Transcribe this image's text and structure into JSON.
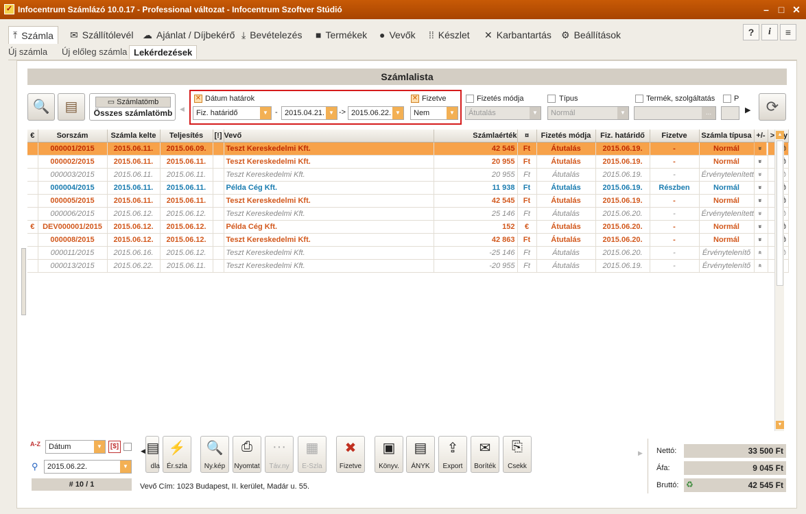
{
  "window": {
    "title": "Infocentrum Számlázó 10.0.17 - Professional változat - Infocentrum Szoftver Stúdió",
    "app_icon_glyph": "✓"
  },
  "main_tabs": [
    {
      "label": "Számla",
      "icon": "upload-icon",
      "glyph": "⤒"
    },
    {
      "label": "Szállítólevél",
      "icon": "envelope-icon",
      "glyph": "✉"
    },
    {
      "label": "Ajánlat / Díjbekérő",
      "icon": "cloud-icon",
      "glyph": "☁"
    },
    {
      "label": "Bevételezés",
      "icon": "download-icon",
      "glyph": "⤓"
    },
    {
      "label": "Termékek",
      "icon": "box-icon",
      "glyph": "■"
    },
    {
      "label": "Vevők",
      "icon": "user-icon",
      "glyph": "●"
    },
    {
      "label": "Készlet",
      "icon": "grid-icon",
      "glyph": "⁞⁞"
    },
    {
      "label": "Karbantartás",
      "icon": "tools-icon",
      "glyph": "✕"
    },
    {
      "label": "Beállítások",
      "icon": "gear-icon",
      "glyph": "⚙"
    }
  ],
  "top_right_icons": {
    "help": "?",
    "info": "i",
    "menu": "≡"
  },
  "sub_tabs": [
    "Új számla",
    "Új előleg számla",
    "Lekérdezések"
  ],
  "list_title": "Számlalista",
  "szamlatomb": {
    "button": "Számlatömb",
    "value": "Összes számlatömb"
  },
  "filters": {
    "datum_hatarok": {
      "label": "Dátum határok",
      "checked": true,
      "field": "Fiz. határidő",
      "from": "2015.04.21.",
      "to": "2015.06.22.",
      "dash": "-",
      "arrow": "->"
    },
    "fizetve": {
      "label": "Fizetve",
      "checked": true,
      "value": "Nem"
    },
    "fizetes_modja": {
      "label": "Fizetés módja",
      "value": "Átutalás"
    },
    "tipus": {
      "label": "Típus",
      "value": "Normál"
    },
    "termek": {
      "label": "Termék, szolgáltatás",
      "ellipsis": "..."
    },
    "p": {
      "label": "P"
    }
  },
  "grid": {
    "headers": [
      "€",
      "Sorszám",
      "Számla kelte",
      "Teljesítés",
      "[!]",
      "Vevő",
      "Számlaérték",
      "¤",
      "Fizetés módja",
      "Fiz. határidő",
      "Fizetve",
      "Számla típusa",
      "+/-",
      ">",
      "Ny"
    ],
    "rows": [
      {
        "cur": "",
        "no": "000001/2015",
        "kelte": "2015.06.11.",
        "telj": "2015.06.09.",
        "vevo": "Teszt Kereskedelmi Kft.",
        "ertek": "42 545",
        "dev": "Ft",
        "mod": "Átutalás",
        "hat": "2015.06.19.",
        "fiz": "-",
        "tip": "Normál",
        "pm": "»",
        "ny": "⎙",
        "cls": "st-normal sel"
      },
      {
        "cur": "",
        "no": "000002/2015",
        "kelte": "2015.06.11.",
        "telj": "2015.06.11.",
        "vevo": "Teszt Kereskedelmi Kft.",
        "ertek": "20 955",
        "dev": "Ft",
        "mod": "Átutalás",
        "hat": "2015.06.19.",
        "fiz": "-",
        "tip": "Normál",
        "pm": "»",
        "ny": "⎙",
        "cls": "st-normal"
      },
      {
        "cur": "",
        "no": "000003/2015",
        "kelte": "2015.06.11.",
        "telj": "2015.06.11.",
        "vevo": "Teszt Kereskedelmi Kft.",
        "ertek": "20 955",
        "dev": "Ft",
        "mod": "Átutalás",
        "hat": "2015.06.19.",
        "fiz": "-",
        "tip": "Érvénytelenített",
        "pm": "»",
        "ny": "⎙",
        "cls": "st-void"
      },
      {
        "cur": "",
        "no": "000004/2015",
        "kelte": "2015.06.11.",
        "telj": "2015.06.11.",
        "vevo": "Példa Cég Kft.",
        "ertek": "11 938",
        "dev": "Ft",
        "mod": "Átutalás",
        "hat": "2015.06.19.",
        "fiz": "Részben",
        "tip": "Normál",
        "pm": "»",
        "ny": "⎙",
        "cls": "st-blue"
      },
      {
        "cur": "",
        "no": "000005/2015",
        "kelte": "2015.06.11.",
        "telj": "2015.06.11.",
        "vevo": "Teszt Kereskedelmi Kft.",
        "ertek": "42 545",
        "dev": "Ft",
        "mod": "Átutalás",
        "hat": "2015.06.19.",
        "fiz": "-",
        "tip": "Normál",
        "pm": "»",
        "ny": "⎙",
        "cls": "st-normal"
      },
      {
        "cur": "",
        "no": "000006/2015",
        "kelte": "2015.06.12.",
        "telj": "2015.06.12.",
        "vevo": "Teszt Kereskedelmi Kft.",
        "ertek": "25 146",
        "dev": "Ft",
        "mod": "Átutalás",
        "hat": "2015.06.20.",
        "fiz": "-",
        "tip": "Érvénytelenített",
        "pm": "»",
        "ny": "⎙",
        "cls": "st-void"
      },
      {
        "cur": "€",
        "no": "DEV000001/2015",
        "kelte": "2015.06.12.",
        "telj": "2015.06.12.",
        "vevo": "Példa Cég Kft.",
        "ertek": "152",
        "dev": "€",
        "mod": "Átutalás",
        "hat": "2015.06.20.",
        "fiz": "-",
        "tip": "Normál",
        "pm": "»",
        "ny": "⎙",
        "cls": "st-normal"
      },
      {
        "cur": "",
        "no": "000008/2015",
        "kelte": "2015.06.12.",
        "telj": "2015.06.12.",
        "vevo": "Teszt Kereskedelmi Kft.",
        "ertek": "42 863",
        "dev": "Ft",
        "mod": "Átutalás",
        "hat": "2015.06.20.",
        "fiz": "-",
        "tip": "Normál",
        "pm": "»",
        "ny": "⎙",
        "cls": "st-normal"
      },
      {
        "cur": "",
        "no": "000011/2015",
        "kelte": "2015.06.16.",
        "telj": "2015.06.12.",
        "vevo": "Teszt Kereskedelmi Kft.",
        "ertek": "-25 146",
        "dev": "Ft",
        "mod": "Átutalás",
        "hat": "2015.06.20.",
        "fiz": "-",
        "tip": "Érvénytelenítő",
        "pm": "«",
        "ny": "⎙",
        "cls": "st-void"
      },
      {
        "cur": "",
        "no": "000013/2015",
        "kelte": "2015.06.22.",
        "telj": "2015.06.11.",
        "vevo": "Teszt Kereskedelmi Kft.",
        "ertek": "-20 955",
        "dev": "Ft",
        "mod": "Átutalás",
        "hat": "2015.06.19.",
        "fiz": "-",
        "tip": "Érvénytelenítő",
        "pm": "«",
        "ny": "",
        "cls": "st-void"
      }
    ]
  },
  "bottom": {
    "sort_label": "Dátum",
    "sort_icon": "A-Z",
    "search_value": "2015.06.22.",
    "dollar": "[$]",
    "record_counter": "# 10 / 1",
    "customer_address": "Vevő Cím: 1023 Budapest, II. kerület, Madár u. 55.",
    "buttons": [
      {
        "label": "dla",
        "glyph": "▤",
        "icon": "partial-icon",
        "dis": false
      },
      {
        "label": "Ér.szla",
        "glyph": "⚡",
        "icon": "void-invoice-icon",
        "dis": false
      },
      {
        "label": "Ny.kép",
        "glyph": "🔍",
        "icon": "preview-icon",
        "dis": false
      },
      {
        "label": "Nyomtat",
        "glyph": "⎙",
        "icon": "printer-icon",
        "dis": false
      },
      {
        "label": "Táv.ny",
        "glyph": "···",
        "icon": "remote-print-icon",
        "dis": true
      },
      {
        "label": "E-Szla",
        "glyph": "▦",
        "icon": "e-invoice-icon",
        "dis": true
      },
      {
        "label": "Fizetve",
        "glyph": "✖",
        "icon": "paid-bag-icon",
        "dis": false
      },
      {
        "label": "Könyv.",
        "glyph": "▣",
        "icon": "accounting-icon",
        "dis": false
      },
      {
        "label": "ÁNYK",
        "glyph": "▤",
        "icon": "anyk-icon",
        "dis": false
      },
      {
        "label": "Export",
        "glyph": "⇪",
        "icon": "export-icon",
        "dis": false
      },
      {
        "label": "Boríték",
        "glyph": "✉",
        "icon": "envelope-print-icon",
        "dis": false
      },
      {
        "label": "Csekk",
        "glyph": "⎘",
        "icon": "check-print-icon",
        "dis": false
      }
    ],
    "totals": {
      "netto_label": "Nettó:",
      "netto": "33 500 Ft",
      "afa_label": "Áfa:",
      "afa": "9 045 Ft",
      "brutto_label": "Bruttó:",
      "brutto": "42 545 Ft"
    }
  }
}
